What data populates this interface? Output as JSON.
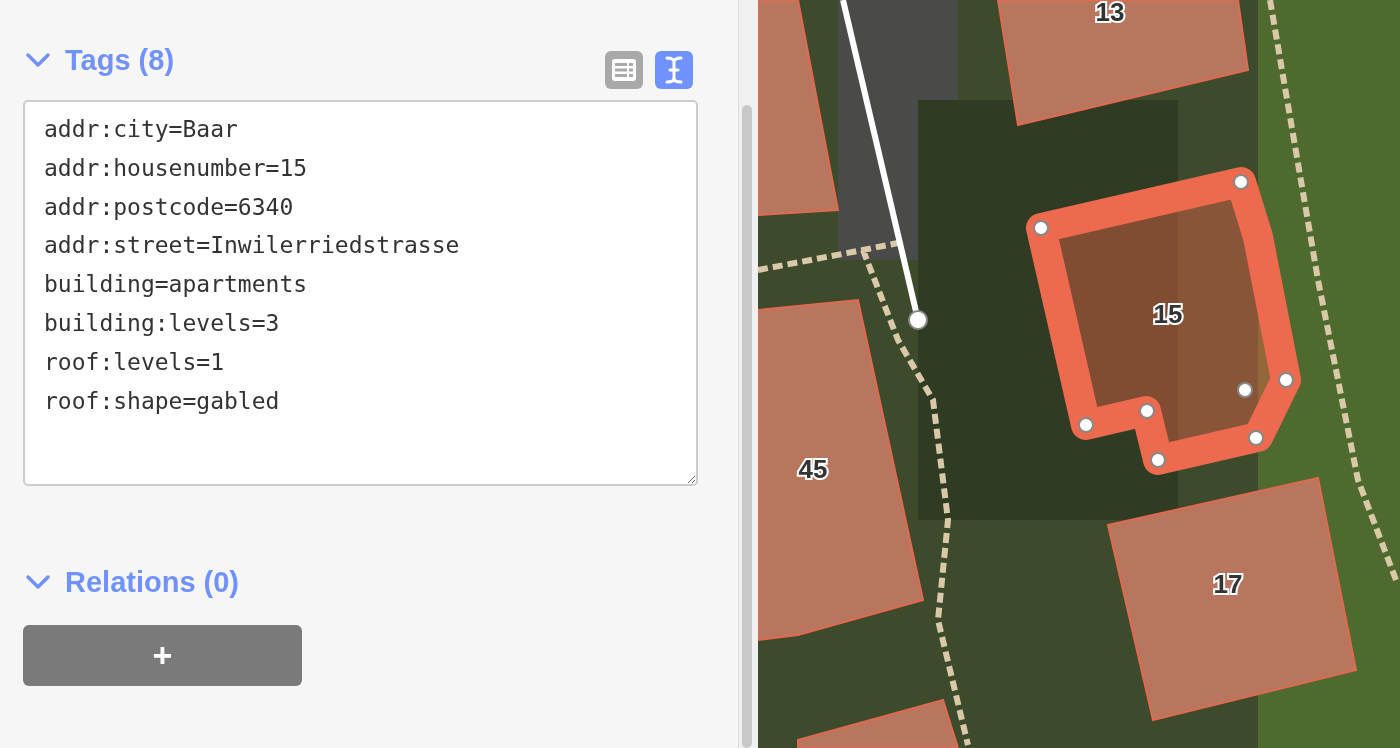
{
  "tags_section": {
    "title": "Tags (8)",
    "expanded": true,
    "view_buttons": [
      {
        "kind": "list",
        "selected": false
      },
      {
        "kind": "text",
        "selected": true
      }
    ],
    "text": "addr:city=Baar\naddr:housenumber=15\naddr:postcode=6340\naddr:street=Inwilerriedstrasse\nbuilding=apartments\nbuilding:levels=3\nroof:levels=1\nroof:shape=gabled"
  },
  "relations_section": {
    "title": "Relations (0)",
    "expanded": true
  },
  "add_button": {
    "label": "+"
  },
  "map": {
    "building_labels": [
      "13",
      "15",
      "45",
      "17"
    ]
  }
}
